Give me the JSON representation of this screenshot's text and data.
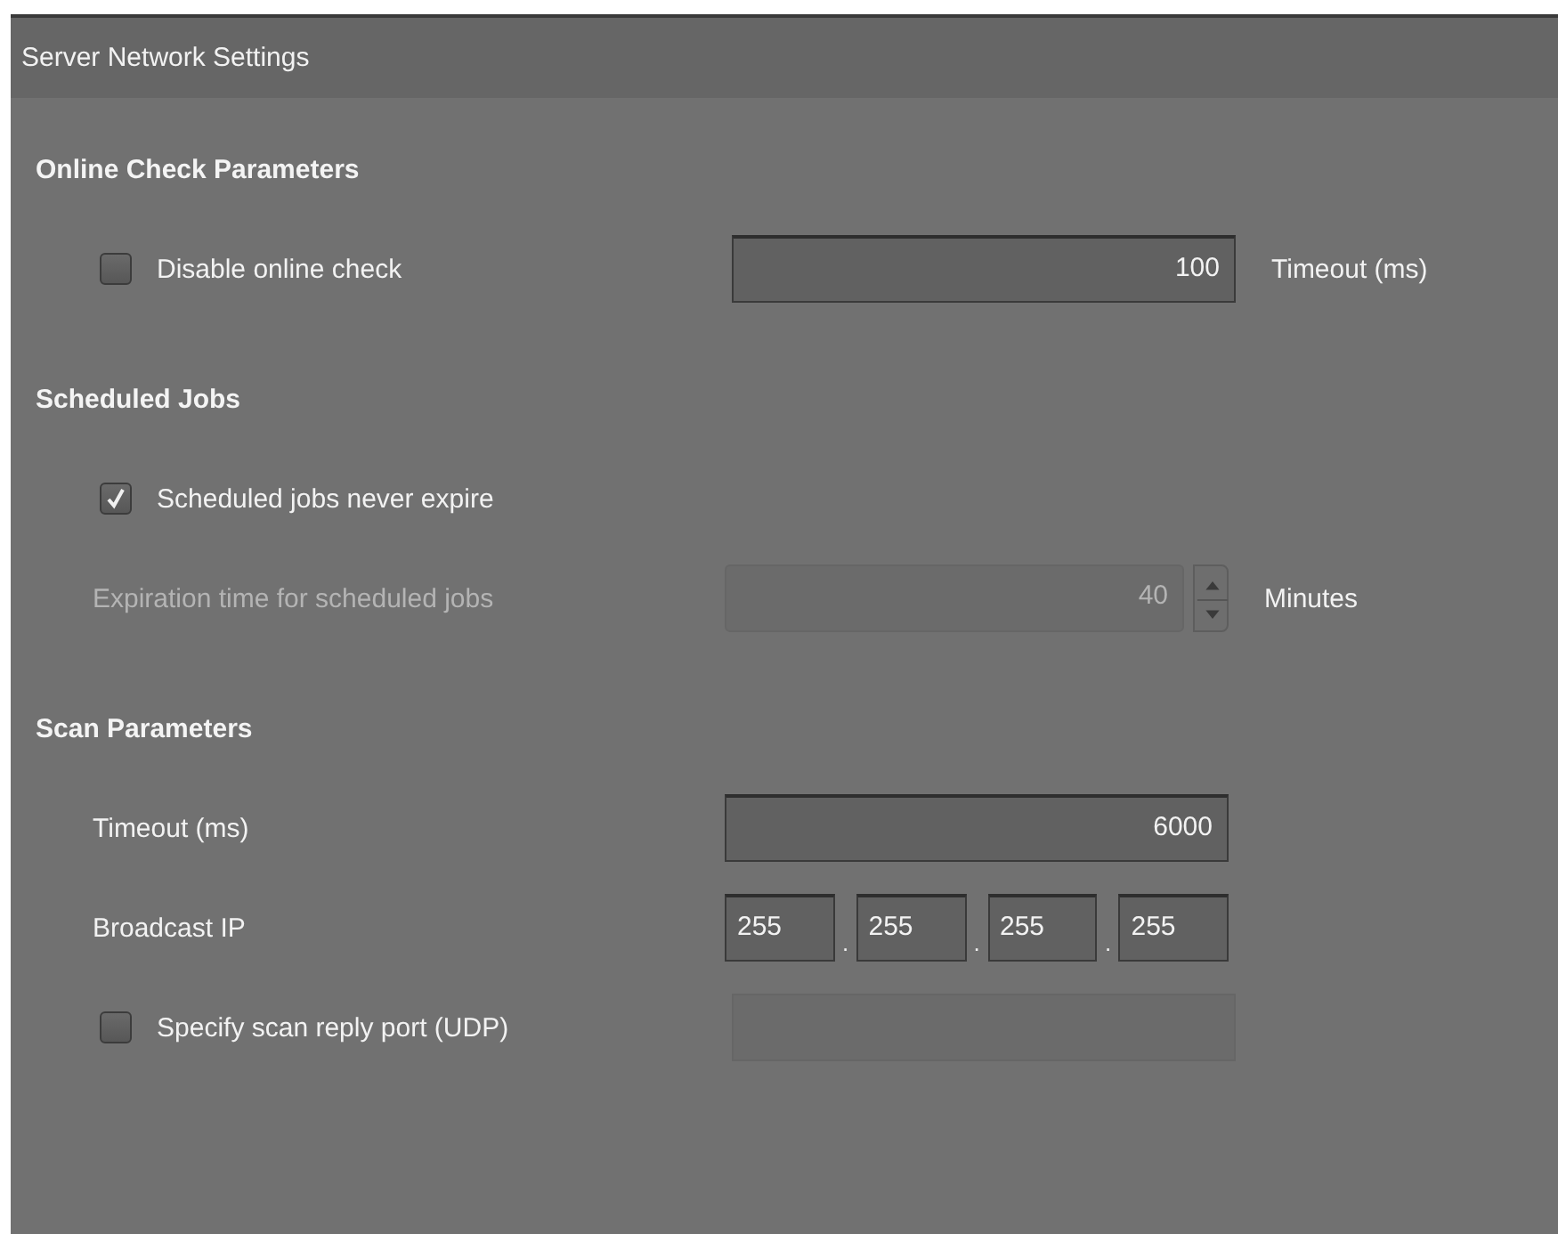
{
  "window": {
    "title": "Server Network Settings"
  },
  "sections": [
    {
      "heading": "Online Check Parameters",
      "rows": [
        {
          "kind": "checkbox",
          "label": "Disable online check",
          "checked": false,
          "field": {
            "value": "100",
            "disabled": false
          },
          "unit": "Timeout (ms)"
        }
      ]
    },
    {
      "heading": "Scheduled Jobs",
      "rows": [
        {
          "kind": "checkbox",
          "label": "Scheduled jobs never expire",
          "checked": true
        },
        {
          "kind": "spinner",
          "label": "Expiration time for scheduled jobs",
          "value": "40",
          "unit": "Minutes",
          "disabled": true
        }
      ]
    },
    {
      "heading": "Scan Parameters",
      "rows": [
        {
          "kind": "field",
          "label": "Timeout (ms)",
          "value": "6000"
        },
        {
          "kind": "ip",
          "label": "Broadcast IP",
          "octets": [
            "255",
            "255",
            "255",
            "255"
          ],
          "separator": "."
        },
        {
          "kind": "checkbox",
          "label": "Specify scan reply port (UDP)",
          "checked": false,
          "field": {
            "disabled": true
          }
        }
      ]
    }
  ]
}
